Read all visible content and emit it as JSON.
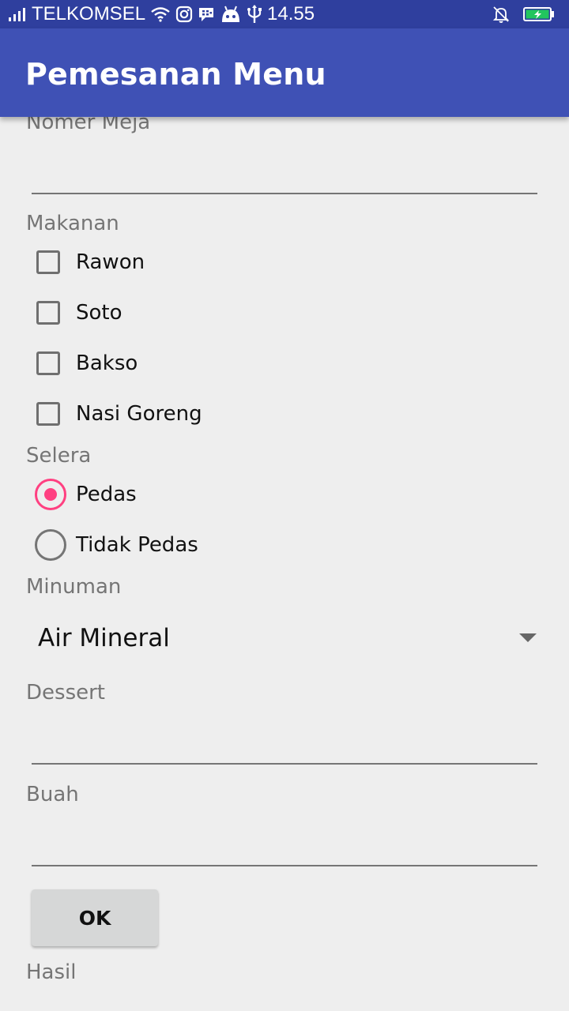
{
  "status_bar": {
    "carrier": "TELKOMSEL",
    "time": "14.55",
    "battery_color": "#22c55e",
    "icons": [
      "signal-icon",
      "wifi-icon",
      "instagram-icon",
      "bbm-icon",
      "android-icon",
      "usb-icon",
      "mute-icon",
      "battery-icon"
    ]
  },
  "app_bar": {
    "title": "Pemesanan Menu",
    "color": "#3f51b5"
  },
  "form": {
    "table_number_label": "Nomer Meja",
    "table_number_value": "",
    "food_label": "Makanan",
    "food_options": [
      {
        "label": "Rawon",
        "checked": false
      },
      {
        "label": "Soto",
        "checked": false
      },
      {
        "label": "Bakso",
        "checked": false
      },
      {
        "label": "Nasi Goreng",
        "checked": false
      }
    ],
    "taste_label": "Selera",
    "taste_options": [
      {
        "label": "Pedas",
        "selected": true
      },
      {
        "label": "Tidak Pedas",
        "selected": false
      }
    ],
    "drink_label": "Minuman",
    "drink_selected": "Air Mineral",
    "dessert_label": "Dessert",
    "dessert_value": "",
    "fruit_label": "Buah",
    "fruit_value": "",
    "ok_button": "OK",
    "result_label": "Hasil",
    "accent_color": "#ff4081"
  }
}
